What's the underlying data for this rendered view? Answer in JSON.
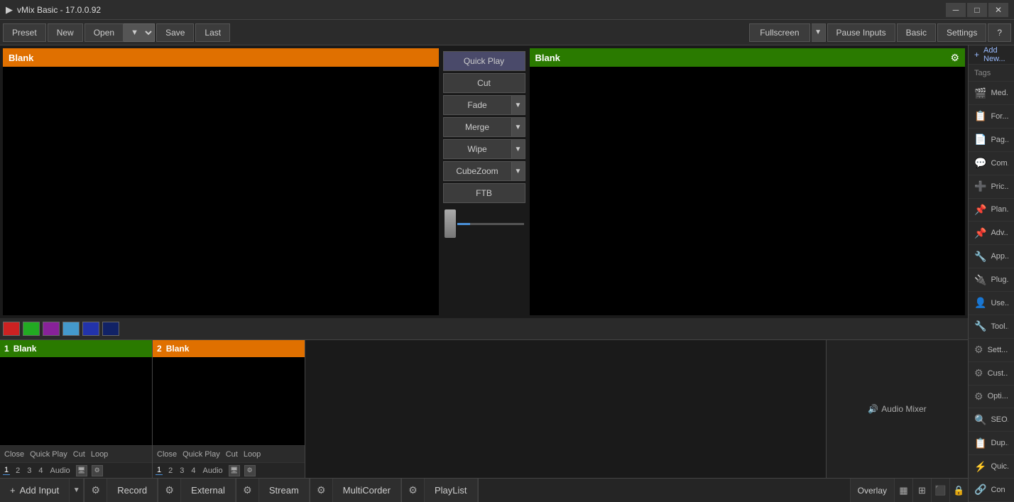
{
  "titlebar": {
    "title": "vMix Basic - 17.0.0.92",
    "icon": "▶",
    "minimize": "─",
    "maximize": "□",
    "close": "✕"
  },
  "toolbar": {
    "preset_label": "Preset",
    "new_label": "New",
    "open_label": "Open",
    "save_label": "Save",
    "last_label": "Last",
    "fullscreen_label": "Fullscreen",
    "pause_inputs_label": "Pause Inputs",
    "basic_label": "Basic",
    "settings_label": "Settings",
    "help_label": "?"
  },
  "preview": {
    "left_label": "Blank",
    "right_label": "Blank",
    "right_gear": "⚙"
  },
  "transitions": {
    "quick_play": "Quick Play",
    "cut": "Cut",
    "fade": "Fade",
    "merge": "Merge",
    "wipe": "Wipe",
    "cube_zoom": "CubeZoom",
    "ftb": "FTB"
  },
  "colors": {
    "red": "#cc2222",
    "green": "#22aa22",
    "purple": "#882299",
    "blue_light": "#4499cc",
    "dark_blue": "#2233aa",
    "navy": "#112266"
  },
  "inputs": [
    {
      "number": "1",
      "label": "Blank",
      "header_color": "green",
      "close_label": "Close",
      "quick_play_label": "Quick Play",
      "cut_label": "Cut",
      "loop_label": "Loop",
      "tabs": [
        "1",
        "2",
        "3",
        "4"
      ],
      "audio_label": "Audio"
    },
    {
      "number": "2",
      "label": "Blank",
      "header_color": "orange",
      "close_label": "Close",
      "quick_play_label": "Quick Play",
      "cut_label": "Cut",
      "loop_label": "Loop",
      "tabs": [
        "1",
        "2",
        "3",
        "4"
      ],
      "audio_label": "Audio"
    }
  ],
  "audio_mixer": {
    "icon": "🔊",
    "label": "Audio Mixer"
  },
  "bottom_bar": {
    "add_input_label": "Add Input",
    "record_label": "Record",
    "external_label": "External",
    "stream_label": "Stream",
    "multicorder_label": "MultiCorder",
    "playlist_label": "PlayList",
    "overlay_label": "Overlay"
  },
  "sidebar": {
    "add_new": "Add New...",
    "tags": "Tags",
    "items": [
      {
        "icon": "🎬",
        "label": "Med..."
      },
      {
        "icon": "📋",
        "label": "For..."
      },
      {
        "icon": "📄",
        "label": "Pag..."
      },
      {
        "icon": "💬",
        "label": "Com..."
      },
      {
        "icon": "➕",
        "label": "Pric..."
      },
      {
        "icon": "📌",
        "label": "Plan..."
      },
      {
        "icon": "📌",
        "label": "Adv..."
      },
      {
        "icon": "🔧",
        "label": "App..."
      },
      {
        "icon": "🔌",
        "label": "Plug..."
      },
      {
        "icon": "👤",
        "label": "Use..."
      },
      {
        "icon": "🔧",
        "label": "Tool..."
      },
      {
        "icon": "⚙",
        "label": "Sett..."
      },
      {
        "icon": "⚙",
        "label": "Cust..."
      },
      {
        "icon": "⚙",
        "label": "Opti..."
      },
      {
        "icon": "🔍",
        "label": "SEO..."
      },
      {
        "icon": "📋",
        "label": "Dup..."
      },
      {
        "icon": "⚡",
        "label": "Quic..."
      },
      {
        "icon": "🔗",
        "label": "Con"
      }
    ]
  }
}
